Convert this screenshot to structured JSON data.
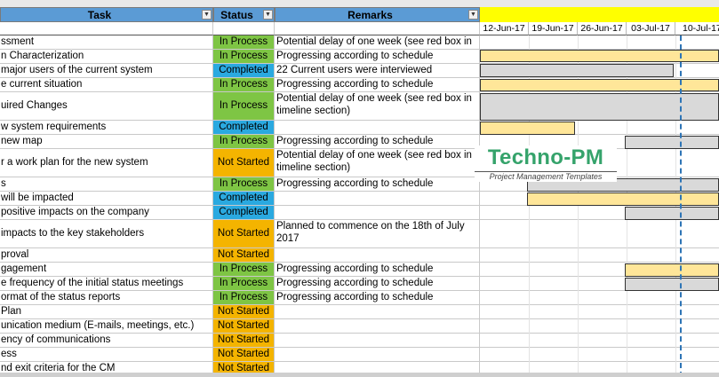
{
  "headers": {
    "task": "Task",
    "status": "Status",
    "remarks": "Remarks",
    "dropdown_glyph": "▼"
  },
  "dates": [
    "12-Jun-17",
    "19-Jun-17",
    "26-Jun-17",
    "03-Jul-17",
    "10-Jul-17"
  ],
  "watermark": {
    "title": "Techno-PM",
    "subtitle": "Project Management Templates"
  },
  "colors": {
    "in_process": "#7ec544",
    "completed": "#2aa9e0",
    "not_started": "#f4b400",
    "header": "#5b9bd5",
    "bar_planned": "#ffe699",
    "bar_actual": "#d9d9d9",
    "today_line": "#2e75b6"
  },
  "rows": [
    {
      "task": "ssment",
      "status": "In Process",
      "remark": "Potential delay of one week (see red box in"
    },
    {
      "task": "n Characterization",
      "status": "In Process",
      "remark": "Progressing according to schedule"
    },
    {
      "task": " major users of the current system",
      "status": "Completed",
      "remark": "22 Current users were interviewed"
    },
    {
      "task": "e current situation",
      "status": "In Process",
      "remark": "Progressing according to schedule"
    },
    {
      "task": "uired Changes",
      "status": "In Process",
      "remark": "Potential delay of one week (see red box in timeline section)"
    },
    {
      "task": "w system requirements",
      "status": "Completed",
      "remark": ""
    },
    {
      "task": "new map",
      "status": "In Process",
      "remark": "Progressing according to schedule"
    },
    {
      "task": "r a work plan for the new system",
      "status": "Not Started",
      "remark": "Potential delay of one week (see red box in timeline section)"
    },
    {
      "task": "s",
      "status": "In Process",
      "remark": "Progressing according to schedule"
    },
    {
      "task": " will be impacted",
      "status": "Completed",
      "remark": ""
    },
    {
      "task": " positive impacts on the company",
      "status": "Completed",
      "remark": ""
    },
    {
      "task": "impacts to the key stakeholders",
      "status": "Not Started",
      "remark": "Planned to commence on the 18th of July 2017"
    },
    {
      "task": "proval",
      "status": "Not Started",
      "remark": ""
    },
    {
      "task": "gagement",
      "status": "In Process",
      "remark": "Progressing according to schedule"
    },
    {
      "task": "e frequency of the initial status meetings",
      "status": "In Process",
      "remark": "Progressing according to schedule"
    },
    {
      "task": "ormat of the status reports",
      "status": "In Process",
      "remark": "Progressing according to schedule"
    },
    {
      "task": "Plan",
      "status": "Not Started",
      "remark": ""
    },
    {
      "task": "unication medium (E-mails, meetings, etc.)",
      "status": "Not Started",
      "remark": ""
    },
    {
      "task": "ency of communications",
      "status": "Not Started",
      "remark": ""
    },
    {
      "task": "ess",
      "status": "Not Started",
      "remark": ""
    },
    {
      "task": "nd exit criteria for the CM",
      "status": "Not Started",
      "remark": ""
    }
  ]
}
